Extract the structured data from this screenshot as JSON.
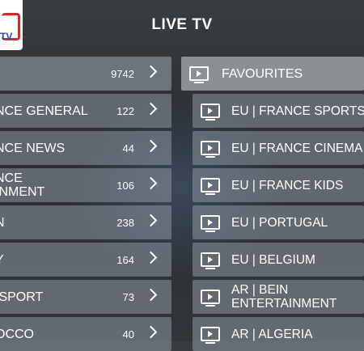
{
  "header": {
    "title": "LIVE TV"
  },
  "logo": {
    "text": "TV"
  },
  "categories": [
    {
      "label": "",
      "count": "9742"
    },
    {
      "label": "NCE GENERAL",
      "count": "122"
    },
    {
      "label": "NCE NEWS",
      "count": "44"
    },
    {
      "label": "NCE\nINMENT",
      "count": "106"
    },
    {
      "label": "N",
      "count": "238"
    },
    {
      "label": "Y",
      "count": "164"
    },
    {
      "label": " SPORT",
      "count": "73"
    },
    {
      "label": "OCCO",
      "count": "40"
    }
  ],
  "favourites": {
    "label": "FAVOURITES"
  },
  "channels": [
    {
      "label": "EU | FRANCE SPORTS"
    },
    {
      "label": "EU | FRANCE CINEMA"
    },
    {
      "label": "EU | FRANCE KIDS"
    },
    {
      "label": "EU | PORTUGAL"
    },
    {
      "label": "EU | BELGIUM"
    },
    {
      "label": "AR | BEIN ENTERTAINMENT"
    },
    {
      "label": "AR | ALGERIA"
    }
  ]
}
